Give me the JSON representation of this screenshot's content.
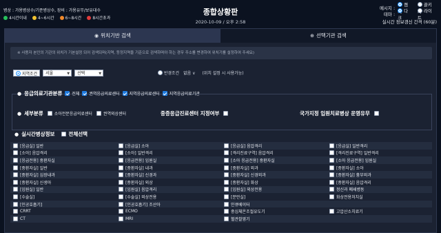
{
  "header": {
    "legend_text": "병상 : 가용병상수/기준병상수, 장비 : 가용유무/보유대수",
    "legend_items": [
      {
        "label": "4시간이내",
        "color": "#27c25c"
      },
      {
        "label": "4~6시간",
        "color": "#f2c230"
      },
      {
        "label": "6~8시간",
        "color": "#f2892a"
      },
      {
        "label": "8시간초과",
        "color": "#e23b3b"
      }
    ],
    "title": "종합상황판",
    "datetime": "2020-10-09 / 오후 2:58",
    "message_label": "메시지 :",
    "message_options": [
      "켬기",
      "끌키기"
    ],
    "theme_label": "테마 :",
    "theme_options": [
      "다크",
      "라이트"
    ],
    "refresh_interval": "실시간 정보갱신 간격 (60분)"
  },
  "tabs": [
    {
      "label": "위치기반 검색",
      "icon": "location-pin-icon"
    },
    {
      "label": "선택기관 검색",
      "icon": "plus-circle-icon"
    }
  ],
  "notice": "※ 사용자 본인의 기관의 위치가 기본설정 되어 검색되며(지역, 등정지역을 기준으로 검색하며야 하는 경우 주소를 변경하여 위치기를 설정하여 주세요)",
  "filters": {
    "region_label": "지역조건",
    "region_value": "서울",
    "region_sub_value": "선택",
    "radius_label": "반경조건",
    "radius_value": "없음",
    "radius_note": "(위치 설정 시 사용가능)",
    "er_class_label": "응급의료기관분류",
    "er_class_options": [
      "전체",
      "권역응급의료센터",
      "지역응급의료센터",
      "지역응급의료기관"
    ],
    "detail_label": "세부분류",
    "detail_options": [
      "소아전문응급의료센터",
      "권역외상센터"
    ],
    "severe_center_label": "중증응급진료센터 지정여부",
    "national_bed_label": "국가지정 입원치료병상 운영유무"
  },
  "realtime": {
    "label": "실시간병상정보",
    "select_all": "전체선택"
  },
  "grid_items": [
    [
      "[응급실] 일반",
      "[응급실] 소아",
      "[응급실] 음압격리",
      "[응급실] 일반격리"
    ],
    [
      "[소아] 음압격리",
      "[소아] 일반격리",
      "[격리진료구역] 음압격리",
      "[격리진료구역] 일반격리"
    ],
    [
      "[응급전용] 중환자실",
      "[응급전용] 입원실",
      "[소아 응급전용] 중환자실",
      "[소아 응급전용] 입원실"
    ],
    [
      "[중환자실] 일반",
      "[중환자실] 내과",
      "[중환자실] 외과",
      "[중환자실] 소아"
    ],
    [
      "[중환자실] 심장내과",
      "[중환자실] 신경과",
      "[중환자실] 신경외과",
      "[중환자실] 흉부외과"
    ],
    [
      "[중환자실] 신생아",
      "[중환자실] 외상",
      "[중환자실] 화상",
      "[중환자실] 음압격리"
    ],
    [
      "[입원실] 일반",
      "[입원실] 음압격리",
      "[입원실] 외상전용",
      "정신과 폐쇄병동"
    ],
    [
      "[수술실]",
      "[수술실] 외상전용",
      "[분만실]",
      "화상전용처치실"
    ],
    [
      "[인공호흡기]",
      "[인공호흡기] 조산아",
      "인큐베이터",
      ""
    ],
    [
      "CRRT",
      "ECMO",
      "중심체온조절유도기",
      "고압산소치료기"
    ],
    [
      "CT",
      "MRI",
      "혈관촬영기",
      ""
    ]
  ]
}
